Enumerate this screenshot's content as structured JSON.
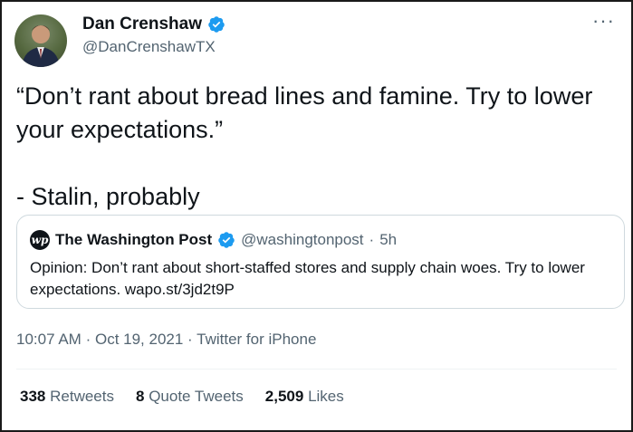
{
  "author": {
    "name": "Dan Crenshaw",
    "handle": "@DanCrenshawTX"
  },
  "more_label": "···",
  "tweet": {
    "text": "“Don’t rant about bread lines and famine. Try to lower your expectations.”\n\n- Stalin, probably"
  },
  "quote": {
    "logo_text": "wp",
    "name": "The Washington Post",
    "handle": "@washingtonpost",
    "separator": "·",
    "age": "5h",
    "text": "Opinion: Don’t rant about short-staffed stores and supply chain woes. Try to lower expectations. wapo.st/3jd2t9P"
  },
  "meta": {
    "time": "10:07 AM",
    "sep1": "·",
    "date": "Oct 19, 2021",
    "sep2": "·",
    "source": "Twitter for iPhone"
  },
  "stats": {
    "retweets_count": "338",
    "retweets_label": "Retweets",
    "quotes_count": "8",
    "quotes_label": "Quote Tweets",
    "likes_count": "2,509",
    "likes_label": "Likes"
  },
  "colors": {
    "verified": "#1d9bf0",
    "text_primary": "#0f1419",
    "text_secondary": "#536471",
    "border": "#cfd9de"
  },
  "icons": {
    "verified": "verified-badge-icon",
    "more": "more-options-icon"
  }
}
